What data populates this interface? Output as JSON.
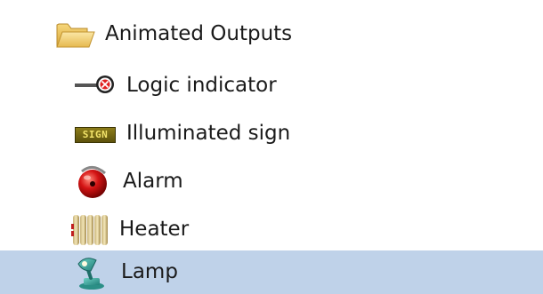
{
  "tree": {
    "folder": {
      "label": "Animated Outputs",
      "icon": "folder-open-icon"
    },
    "items": [
      {
        "label": "Logic indicator",
        "icon": "logic-indicator-icon"
      },
      {
        "label": "Illuminated sign",
        "icon": "illuminated-sign-icon",
        "badge_text": "SIGN"
      },
      {
        "label": "Alarm",
        "icon": "alarm-bell-icon"
      },
      {
        "label": "Heater",
        "icon": "heater-icon"
      },
      {
        "label": "Lamp",
        "icon": "lamp-icon",
        "selected": true
      }
    ],
    "selection_color": "#bfd2e9"
  }
}
